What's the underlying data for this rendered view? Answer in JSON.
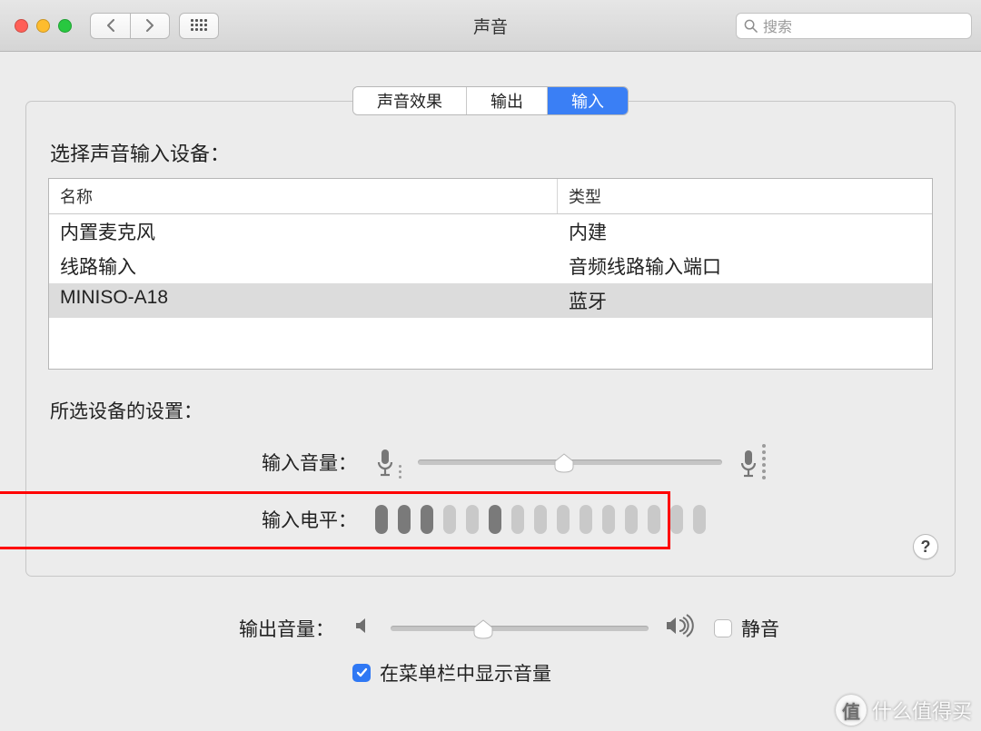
{
  "window": {
    "title": "声音"
  },
  "toolbar": {
    "search_placeholder": "搜索"
  },
  "tabs": [
    {
      "label": "声音效果",
      "active": false
    },
    {
      "label": "输出",
      "active": false
    },
    {
      "label": "输入",
      "active": true
    }
  ],
  "section": {
    "choose_device_heading": "选择声音输入设备：",
    "columns": {
      "name": "名称",
      "type": "类型"
    },
    "devices": [
      {
        "name": "内置麦克风",
        "type": "内建",
        "selected": false
      },
      {
        "name": "线路输入",
        "type": "音频线路输入端口",
        "selected": false
      },
      {
        "name": "MINISO-A18",
        "type": "蓝牙",
        "selected": true
      }
    ],
    "selected_settings_heading": "所选设备的设置：",
    "input_volume_label": "输入音量：",
    "input_volume_percent": 48,
    "input_level_label": "输入电平：",
    "input_level_bars": [
      true,
      true,
      true,
      false,
      false,
      true,
      false,
      false,
      false,
      false,
      false,
      false,
      false,
      false,
      false
    ],
    "help_label": "?"
  },
  "output": {
    "output_volume_label": "输出音量：",
    "output_volume_percent": 36,
    "mute_label": "静音",
    "mute_checked": false,
    "show_in_menubar_label": "在菜单栏中显示音量",
    "show_in_menubar_checked": true
  },
  "watermark": "什么值得买"
}
